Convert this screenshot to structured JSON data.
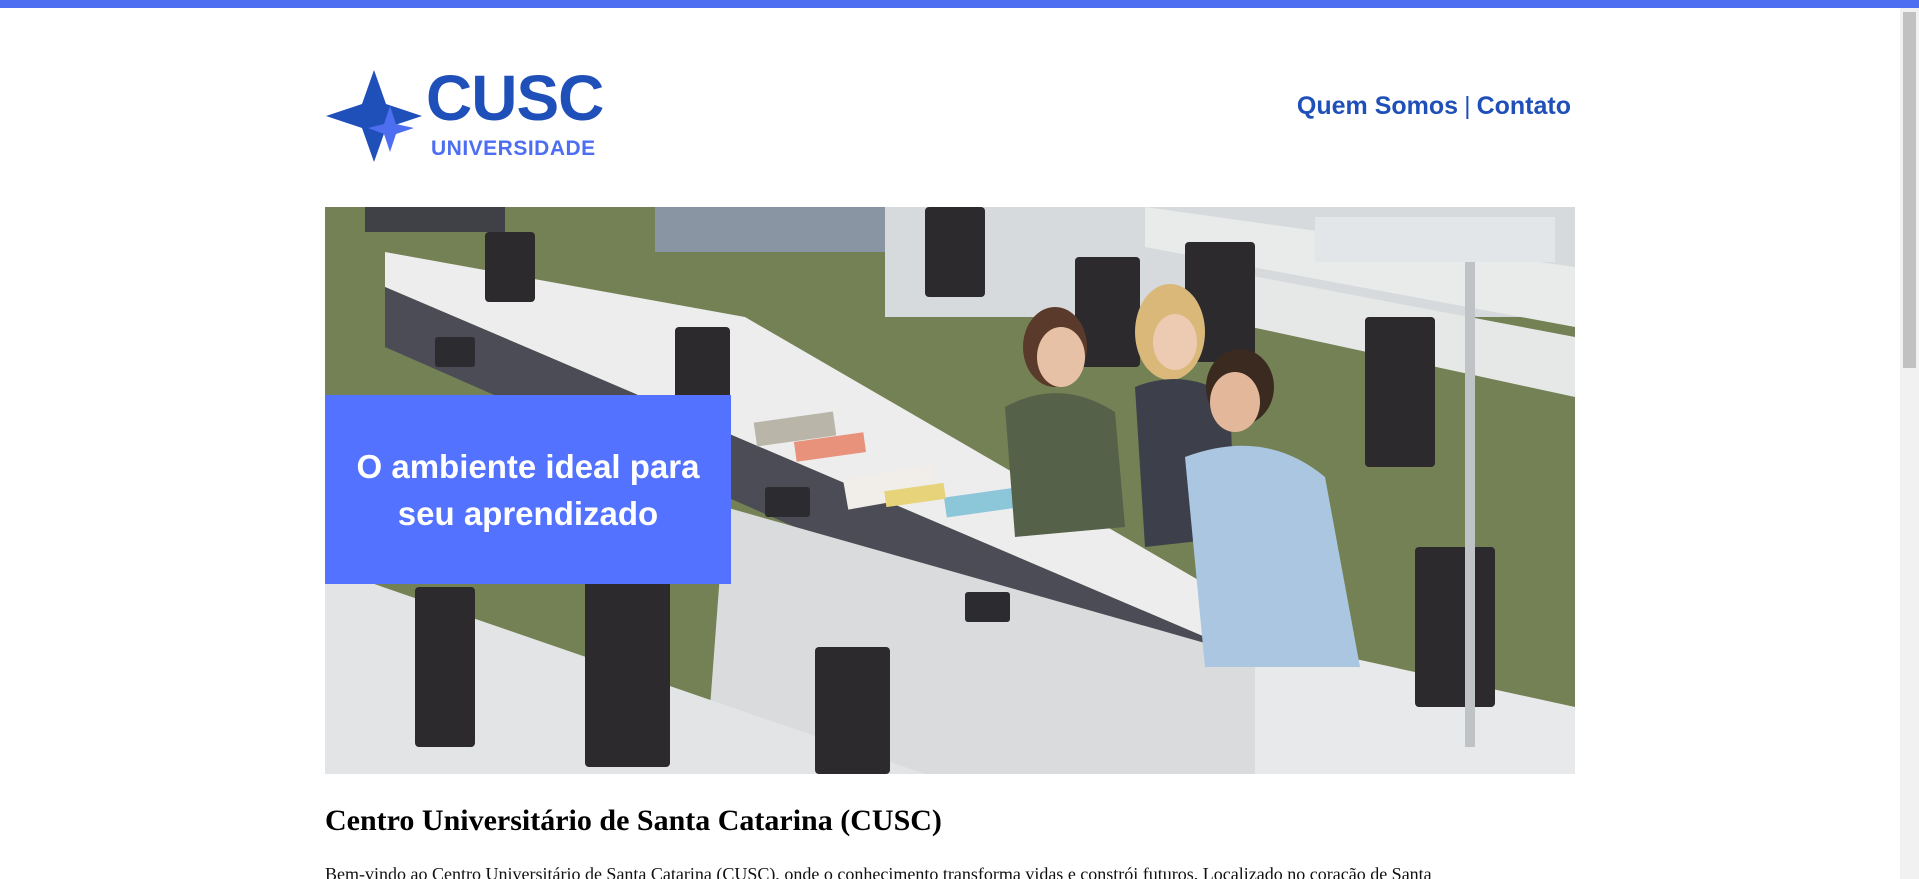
{
  "brand": {
    "name": "CUSC",
    "subtitle": "UNIVERSIDADE",
    "primary_color": "#1f4fb8",
    "accent_color": "#4e6ef2",
    "logo_icon": "four-point-star-icon"
  },
  "nav": {
    "items": [
      "Quem Somos",
      "Contato"
    ],
    "separator": "|"
  },
  "hero": {
    "banner_text": "O ambiente ideal para seu aprendizado",
    "banner_color": "#5272ff",
    "image": "students-studying-in-library-photo"
  },
  "content": {
    "title": "Centro Universitário de Santa Catarina (CUSC)",
    "intro": "Bem-vindo ao Centro Universitário de Santa Catarina (CUSC), onde o conhecimento transforma vidas e constrói futuros. Localizado no coração de Santa"
  }
}
